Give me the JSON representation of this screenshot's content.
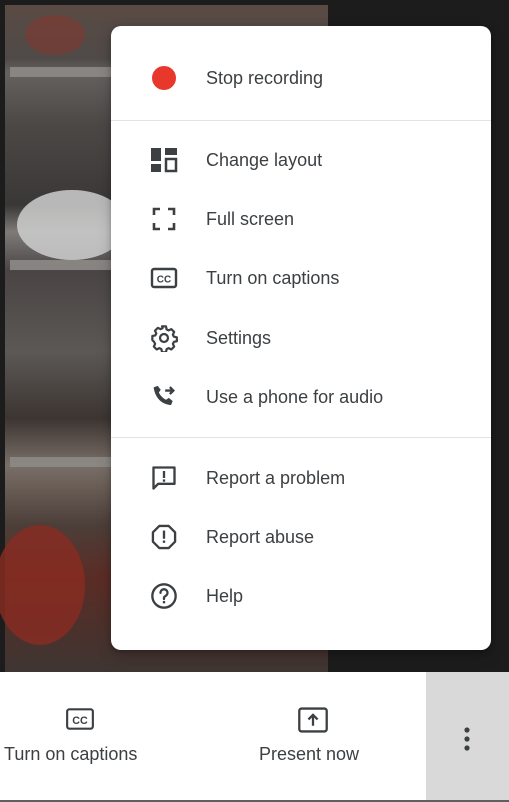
{
  "menu": {
    "items": [
      {
        "id": "stop-recording",
        "label": "Stop recording",
        "icon": "record-dot-icon"
      },
      {
        "id": "change-layout",
        "label": "Change layout",
        "icon": "layout-icon"
      },
      {
        "id": "full-screen",
        "label": "Full screen",
        "icon": "fullscreen-icon"
      },
      {
        "id": "turn-on-captions",
        "label": "Turn on captions",
        "icon": "captions-icon"
      },
      {
        "id": "settings",
        "label": "Settings",
        "icon": "gear-icon"
      },
      {
        "id": "use-phone",
        "label": "Use a phone for audio",
        "icon": "phone-forward-icon"
      },
      {
        "id": "report-problem",
        "label": "Report a problem",
        "icon": "feedback-icon"
      },
      {
        "id": "report-abuse",
        "label": "Report abuse",
        "icon": "report-icon"
      },
      {
        "id": "help",
        "label": "Help",
        "icon": "help-icon"
      }
    ]
  },
  "bottom_bar": {
    "captions_label": "Turn on captions",
    "present_label": "Present now",
    "more_icon": "more-vert-icon"
  },
  "colors": {
    "record": "#e8382c",
    "text": "#3c4043",
    "icon": "#3c4043",
    "more_bg": "#d9d9d9"
  }
}
